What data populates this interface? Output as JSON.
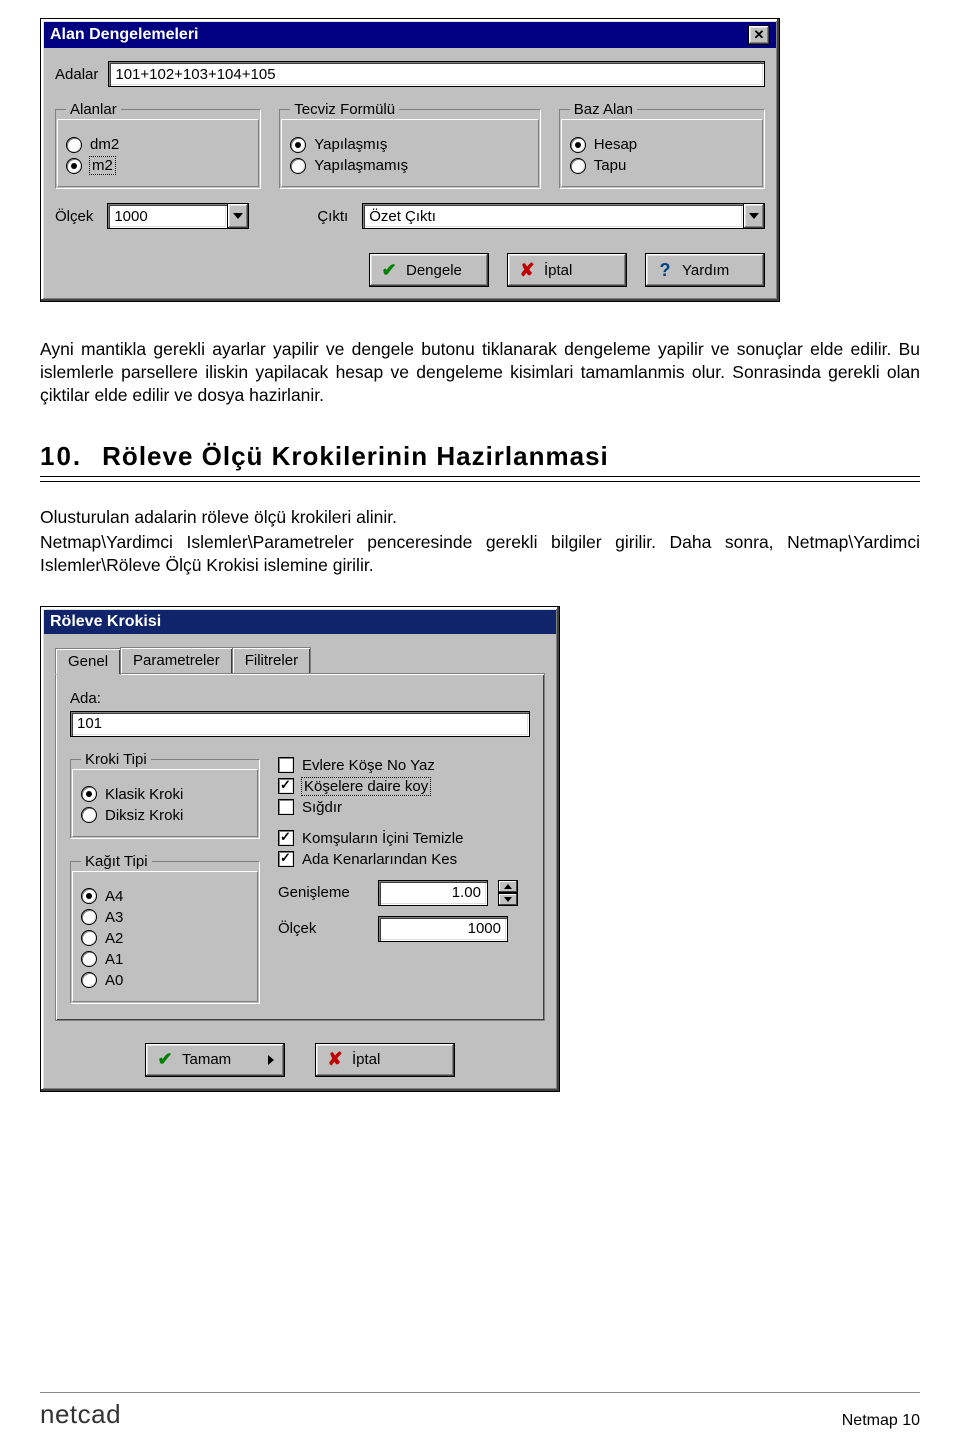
{
  "dialog1": {
    "title": "Alan Dengelemeleri",
    "adalar_label": "Adalar",
    "adalar_value": "101+102+103+104+105",
    "groups": {
      "alanlar": {
        "legend": "Alanlar",
        "options": {
          "dm2": "dm2",
          "m2": "m2"
        },
        "selected": "m2"
      },
      "tecviz": {
        "legend": "Tecviz Formülü",
        "options": {
          "yapilasmis": "Yapılaşmış",
          "yapilasmamis": "Yapılaşmamış"
        },
        "selected": "yapilasmis"
      },
      "baz": {
        "legend": "Baz Alan",
        "options": {
          "hesap": "Hesap",
          "tapu": "Tapu"
        },
        "selected": "hesap"
      }
    },
    "olcek_label": "Ölçek",
    "olcek_value": "1000",
    "cikti_label": "Çıktı",
    "cikti_value": "Özet Çıktı",
    "buttons": {
      "dengele": "Dengele",
      "iptal": "İptal",
      "yardim": "Yardım"
    }
  },
  "text": {
    "p1": "Ayni mantikla gerekli ayarlar yapilir ve dengele butonu tiklanarak dengeleme yapilir ve sonuçlar elde edilir. Bu islemlerle  parsellere iliskin yapilacak hesap ve dengeleme kisimlari tamamlanmis olur. Sonrasinda gerekli olan çiktilar elde edilir ve dosya  hazirlanir.",
    "h_num": "10.",
    "h_txt": "Röleve Ölçü Krokilerinin Hazirlanmasi",
    "p2a": "Olusturulan adalarin röleve ölçü krokileri alinir.",
    "p2b": "Netmap\\Yardimci Islemler\\Parametreler penceresinde  gerekli bilgiler girilir. Daha sonra, Netmap\\Yardimci Islemler\\Röleve Ölçü Krokisi islemine girilir."
  },
  "dialog2": {
    "title": "Röleve Krokisi",
    "tabs": {
      "genel": "Genel",
      "parametreler": "Parametreler",
      "filtreler": "Filitreler"
    },
    "ada_label": "Ada:",
    "ada_value": "101",
    "kroki": {
      "legend": "Kroki Tipi",
      "options": {
        "klasik": "Klasik Kroki",
        "diksiz": "Diksiz Kroki"
      },
      "selected": "klasik"
    },
    "kagit": {
      "legend": "Kağıt Tipi",
      "options": {
        "a4": "A4",
        "a3": "A3",
        "a2": "A2",
        "a1": "A1",
        "a0": "A0"
      },
      "selected": "a4"
    },
    "checks": {
      "evlere": {
        "label": "Evlere Köşe No Yaz",
        "checked": false
      },
      "koselere": {
        "label": "Köşelere daire koy",
        "checked": true
      },
      "sigdir": {
        "label": "Sığdır",
        "checked": false
      },
      "komsu": {
        "label": "Komşuların İçini Temizle",
        "checked": true
      },
      "kenar": {
        "label": "Ada Kenarlarından Kes",
        "checked": true
      }
    },
    "genisleme_label": "Genişleme",
    "genisleme_value": "1.00",
    "olcek_label": "Ölçek",
    "olcek_value": "1000",
    "buttons": {
      "tamam": "Tamam",
      "iptal": "İptal"
    }
  },
  "footer": {
    "brand": "netcad",
    "page": "Netmap 10"
  }
}
